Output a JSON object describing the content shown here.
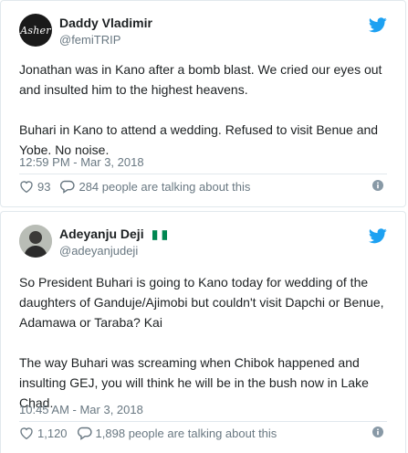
{
  "brand_color": "#1da1f2",
  "tweets": [
    {
      "avatar_text": "Asher",
      "name": "Daddy Vladimir",
      "handle": "@femiTRIP",
      "paragraphs": [
        "Jonathan was in Kano after a bomb blast. We cried our eyes out and insulted him to the highest heavens.",
        "Buhari in Kano to attend a wedding. Refused to visit Benue and Yobe. No noise."
      ],
      "timestamp": "12:59 PM - Mar 3, 2018",
      "likes": "93",
      "talking": "284 people are talking about this"
    },
    {
      "name": "Adeyanju Deji",
      "flag_icon": "nigeria-flag-icon",
      "handle": "@adeyanjudeji",
      "paragraphs": [
        "So President Buhari is going to Kano today for wedding of the daughters of Ganduje/Ajimobi but couldn't visit Dapchi or Benue, Adamawa or Taraba? Kai",
        "The way Buhari was screaming when Chibok happened and insulting GEJ, you will think he will be in the bush now in Lake Chad."
      ],
      "timestamp": "10:45 AM - Mar 3, 2018",
      "likes": "1,120",
      "talking": "1,898 people are talking about this"
    }
  ]
}
